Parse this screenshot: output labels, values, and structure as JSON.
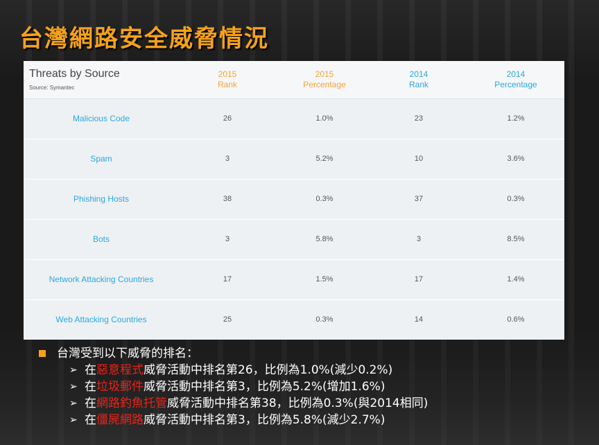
{
  "title": "台灣網路安全威脅情況",
  "table": {
    "heading": "Threats by Source",
    "source": "Source: Symantec",
    "columns": [
      {
        "year": "2015",
        "metric": "Rank",
        "color": "#f5a23a"
      },
      {
        "year": "2015",
        "metric": "Percentage",
        "color": "#f5a23a"
      },
      {
        "year": "2014",
        "metric": "Rank",
        "color": "#2aa8e0"
      },
      {
        "year": "2014",
        "metric": "Percentage",
        "color": "#2aa8e0"
      }
    ],
    "rows": [
      {
        "name": "Malicious Code",
        "r2015": "26",
        "p2015": "1.0%",
        "r2014": "23",
        "p2014": "1.2%"
      },
      {
        "name": "Spam",
        "r2015": "3",
        "p2015": "5.2%",
        "r2014": "10",
        "p2014": "3.6%"
      },
      {
        "name": "Phishing Hosts",
        "r2015": "38",
        "p2015": "0.3%",
        "r2014": "37",
        "p2014": "0.3%"
      },
      {
        "name": "Bots",
        "r2015": "3",
        "p2015": "5.8%",
        "r2014": "3",
        "p2014": "8.5%"
      },
      {
        "name": "Network Attacking Countries",
        "r2015": "17",
        "p2015": "1.5%",
        "r2014": "17",
        "p2014": "1.4%"
      },
      {
        "name": "Web Attacking Countries",
        "r2015": "25",
        "p2015": "0.3%",
        "r2014": "14",
        "p2014": "0.6%"
      }
    ]
  },
  "summary": {
    "main": "台灣受到以下威脅的排名：",
    "items": [
      {
        "prefix": "在",
        "highlight": "惡意程式",
        "rest": "威脅活動中排名第26，比例為1.0%(減少0.2%)"
      },
      {
        "prefix": "在",
        "highlight": "垃圾郵件",
        "rest": "威脅活動中排名第3，比例為5.2%(增加1.6%)"
      },
      {
        "prefix": "在",
        "highlight": "網路釣魚托管",
        "rest": "威脅活動中排名第38，比例為0.3%(與2014相同)"
      },
      {
        "prefix": "在",
        "highlight": "僵屍網路",
        "rest": "威脅活動中排名第3，比例為5.8%(減少2.7%)"
      }
    ]
  },
  "colors": {
    "accent": "#f5a21b",
    "highlight": "#e8241b",
    "table_blue": "#2aa8e0"
  }
}
